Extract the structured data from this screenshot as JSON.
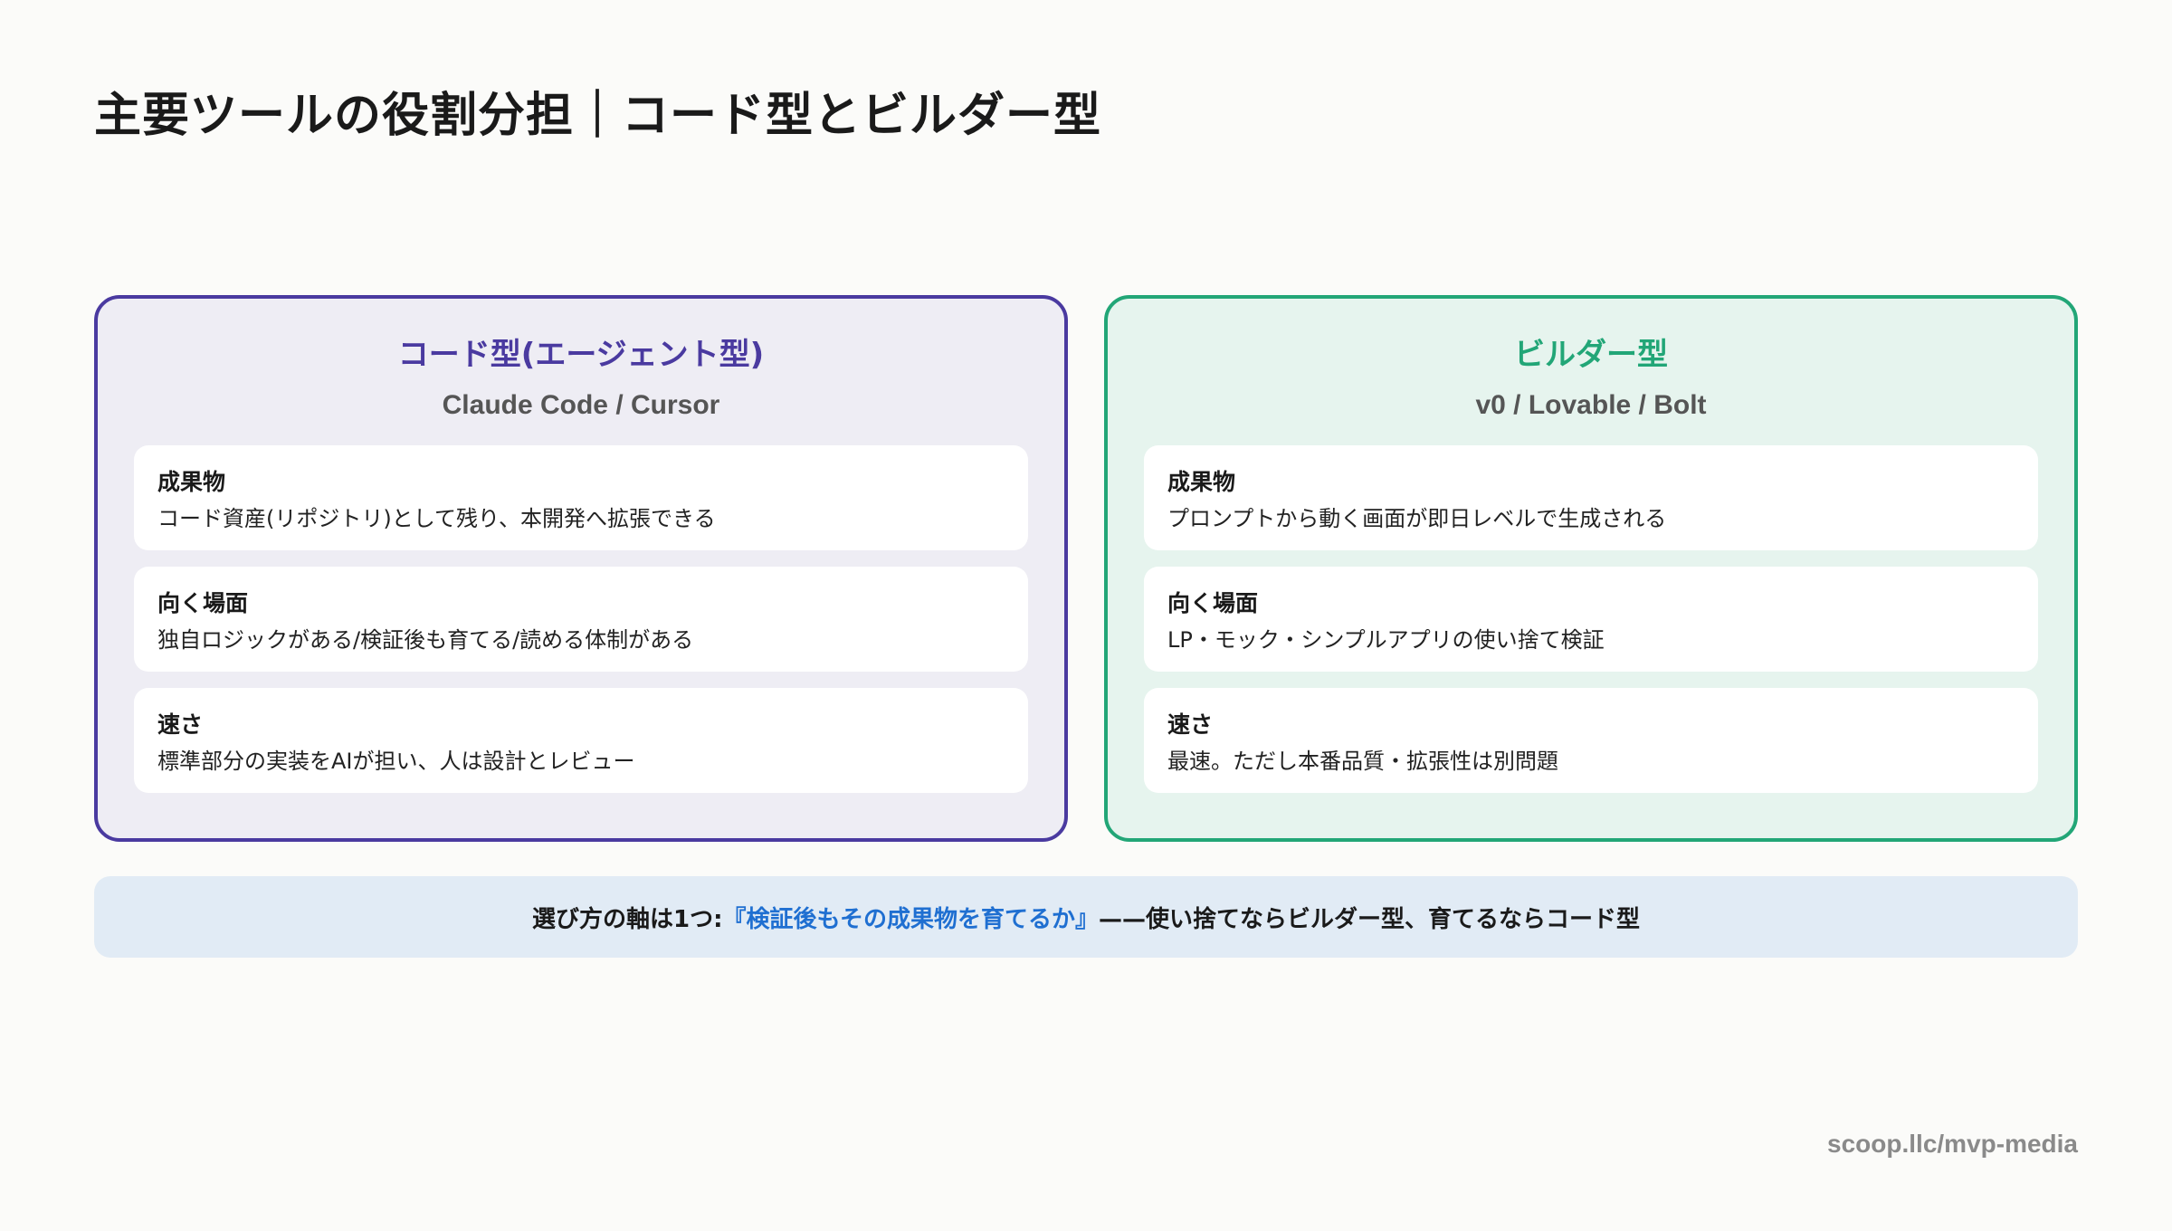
{
  "page": {
    "title": "主要ツールの役割分担｜コード型とビルダー型"
  },
  "panels": {
    "code": {
      "title": "コード型(エージェント型)",
      "subtitle": "Claude Code / Cursor",
      "items": [
        {
          "label": "成果物",
          "text": "コード資産(リポジトリ)として残り、本開発へ拡張できる"
        },
        {
          "label": "向く場面",
          "text": "独自ロジックがある/検証後も育てる/読める体制がある"
        },
        {
          "label": "速さ",
          "text": "標準部分の実装をAIが担い、人は設計とレビュー"
        }
      ]
    },
    "builder": {
      "title": "ビルダー型",
      "subtitle": "v0 / Lovable / Bolt",
      "items": [
        {
          "label": "成果物",
          "text": "プロンプトから動く画面が即日レベルで生成される"
        },
        {
          "label": "向く場面",
          "text": "LP・モック・シンプルアプリの使い捨て検証"
        },
        {
          "label": "速さ",
          "text": "最速。ただし本番品質・拡張性は別問題"
        }
      ]
    }
  },
  "summary": {
    "prefix": "選び方の軸は1つ: ",
    "highlight": "『検証後もその成果物を育てるか』",
    "suffix": "——使い捨てならビルダー型、育てるならコード型"
  },
  "footer": {
    "url": "scoop.llc/mvp-media"
  },
  "colors": {
    "code_accent": "#4a3aa0",
    "builder_accent": "#22a677",
    "highlight": "#1f6fd1"
  }
}
